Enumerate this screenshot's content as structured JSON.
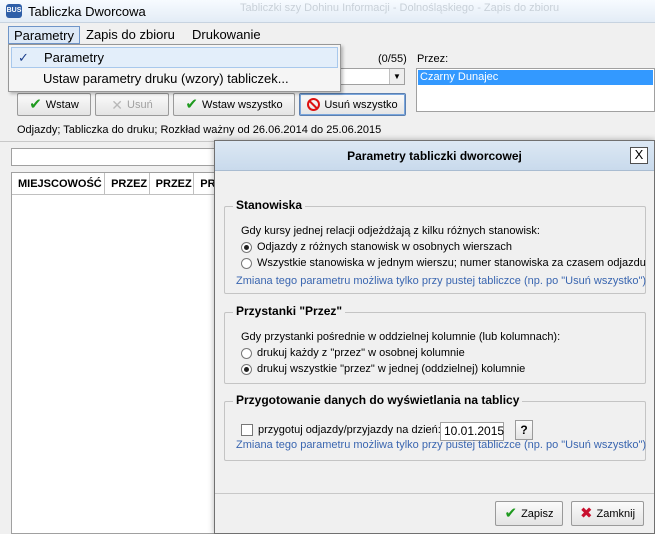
{
  "window": {
    "title": "Tabliczka Dworcowa",
    "ghost_title": "Tabliczki szy Dohinu Informacji - Dolnośląskiego - Zapis do zbioru"
  },
  "menubar": {
    "items": [
      {
        "label": "Parametry"
      },
      {
        "label": "Zapis do zbioru"
      },
      {
        "label": "Drukowanie"
      }
    ]
  },
  "dropdown": {
    "items": [
      {
        "label": "Parametry",
        "checked": true
      },
      {
        "label": "Ustaw parametry druku (wzory) tabliczek..."
      }
    ]
  },
  "main": {
    "count": "(0/55)",
    "przez_label": "Przez:",
    "przez_selected": "Czarny Dunajec",
    "buttons": {
      "wstaw": "Wstaw",
      "usun": "Usuń",
      "wstaw_wszystko": "Wstaw wszystko",
      "usun_wszystko": "Usuń wszystko"
    },
    "info": "Odjazdy; Tabliczka do druku; Rozkład ważny od 26.06.2014 do 25.06.2015",
    "grid_columns": [
      "MIEJSCOWOŚĆ",
      "PRZEZ",
      "PRZEZ",
      "PR"
    ]
  },
  "dialog": {
    "title": "Parametry tabliczki dworcowej",
    "close_glyph": "X",
    "stanowiska": {
      "legend": "Stanowiska",
      "question": "Gdy kursy jednej relacji odjeżdżają z kilku różnych stanowisk:",
      "options": [
        {
          "label": "Odjazdy z różnych stanowisk w osobnych wierszach",
          "selected": true
        },
        {
          "label": "Wszystkie stanowiska w jednym wierszu;  numer stanowiska za czasem odjazdu",
          "selected": false
        }
      ],
      "note": "Zmiana tego parametru możliwa tylko przy pustej tabliczce (np. po \"Usuń wszystko\")"
    },
    "przystanki": {
      "legend": "Przystanki \"Przez\"",
      "question": "Gdy przystanki pośrednie w oddzielnej kolumnie (lub kolumnach):",
      "options": [
        {
          "label": "drukuj każdy z \"przez\" w osobnej kolumnie",
          "selected": false
        },
        {
          "label": "drukuj wszystkie \"przez\" w jednej (oddzielnej) kolumnie",
          "selected": true
        }
      ]
    },
    "przygotowanie": {
      "legend": "Przygotowanie danych do wyświetlania na tablicy",
      "checkbox_label": "przygotuj odjazdy/przyjazdy na dzień:",
      "checked": false,
      "date": "10.01.2015",
      "help": "?",
      "note": "Zmiana tego parametru możliwa tylko przy pustej tabliczce (np. po \"Usuń wszystko\")"
    },
    "buttons": {
      "save": "Zapisz",
      "close": "Zamknij"
    }
  },
  "colors": {
    "note_blue": "#3a66b0",
    "selection_blue": "#3399ff",
    "check_green": "#1f9a1f",
    "cancel_red": "#c8102e"
  }
}
